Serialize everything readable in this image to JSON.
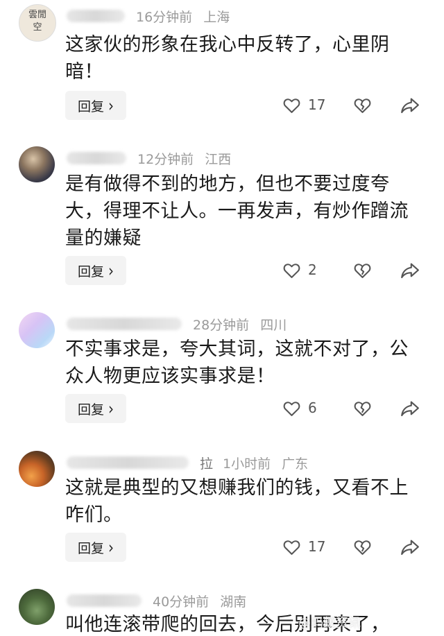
{
  "comments": [
    {
      "time": "16分钟前",
      "location": "上海",
      "partial_name": "",
      "avatar_text": "雲閒空",
      "text": "这家伙的形象在我心中反转了，心里阴暗！",
      "reply_label": "回复",
      "likes": "17"
    },
    {
      "time": "12分钟前",
      "location": "江西",
      "partial_name": "",
      "text": "是有做得不到的地方，但也不要过度夸大，得理不让人。一再发声，有炒作蹭流量的嫌疑",
      "reply_label": "回复",
      "likes": "2"
    },
    {
      "time": "28分钟前",
      "location": "四川",
      "partial_name": "",
      "text": "不实事求是，夸大其词，这就不对了，公众人物更应该实事求是！",
      "reply_label": "回复",
      "likes": "6"
    },
    {
      "time": "1小时前",
      "location": "广东",
      "partial_name": "拉",
      "text": "这就是典型的又想赚我们的钱，又看不上咋们。",
      "reply_label": "回复",
      "likes": "17"
    },
    {
      "time": "40分钟前",
      "location": "湖南",
      "partial_name": "",
      "text": "叫他连滚带爬的回去，今后别再来了，",
      "reply_label": "",
      "likes": ""
    }
  ],
  "icons": {
    "like": "heart-outline-icon",
    "dislike": "broken-heart-icon",
    "share": "share-arrow-icon",
    "reply_arrow": "chevron-right-icon"
  },
  "watermark": "@蚂蚁资讯"
}
